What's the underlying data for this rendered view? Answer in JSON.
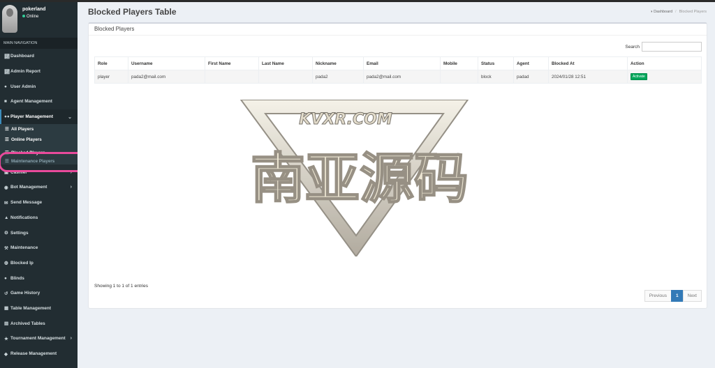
{
  "sidebar": {
    "user": {
      "name": "pokerland",
      "status": "Online"
    },
    "header": "MAIN NAVIGATION",
    "items": [
      {
        "label": "Dashboard",
        "icon": "chart-icon"
      },
      {
        "label": "Admin Report",
        "icon": "chart-icon"
      },
      {
        "label": "User Admin",
        "icon": "user-icon"
      },
      {
        "label": "Agent Management",
        "icon": "agent-icon"
      },
      {
        "label": "Player Management",
        "icon": "users-icon"
      }
    ],
    "player_submenu": [
      {
        "label": "All Players"
      },
      {
        "label": "Online Players"
      },
      {
        "label": "Blocked Players"
      },
      {
        "label": "Maintenance Players"
      }
    ],
    "items_after": [
      {
        "label": "Cashier",
        "icon": "cashier-icon"
      },
      {
        "label": "Bot Management",
        "icon": "bot-icon"
      },
      {
        "label": "Send Message",
        "icon": "message-icon"
      },
      {
        "label": "Notifications",
        "icon": "bell-icon"
      },
      {
        "label": "Settings",
        "icon": "gear-icon"
      },
      {
        "label": "Maintenance",
        "icon": "wrench-icon"
      },
      {
        "label": "Blocked Ip",
        "icon": "block-icon"
      },
      {
        "label": "Blinds",
        "icon": "blinds-icon"
      },
      {
        "label": "Game History",
        "icon": "history-icon"
      },
      {
        "label": "Table Management",
        "icon": "table-icon"
      },
      {
        "label": "Archived Tables",
        "icon": "archive-icon"
      },
      {
        "label": "Tournament Management",
        "icon": "trophy-icon"
      },
      {
        "label": "Release Management",
        "icon": "release-icon"
      }
    ]
  },
  "page": {
    "title": "Blocked Players Table",
    "breadcrumb": [
      "Dashboard",
      "Blocked Players"
    ]
  },
  "box": {
    "title": "Blocked Players",
    "search_label": "Search",
    "search_value": "",
    "columns": [
      "Role",
      "Username",
      "First Name",
      "Last Name",
      "Nickname",
      "Email",
      "Mobile",
      "Status",
      "Agent",
      "Blocked At",
      "Action"
    ],
    "rows": [
      {
        "role": "player",
        "username": "pada2@mail.com",
        "first_name": "",
        "last_name": "",
        "nickname": "pada2",
        "email": "pada2@mail.com",
        "mobile": "",
        "status": "block",
        "agent": "padad",
        "blocked_at": "2024/01/28 12:51",
        "action": "Activate"
      }
    ],
    "info": "Showing 1 to 1 of 1 entries",
    "pagination": {
      "previous": "Previous",
      "current": "1",
      "next": "Next"
    }
  },
  "watermark": {
    "site": "KVXR.COM",
    "text": "南亚源码"
  },
  "colors": {
    "sidebar_bg": "#222d32",
    "accent": "#3c8dbc",
    "success": "#00a65a",
    "highlight": "#e84a9b"
  }
}
